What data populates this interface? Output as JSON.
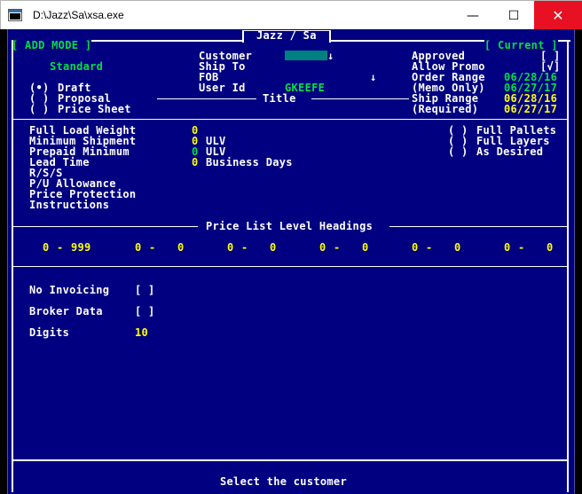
{
  "window": {
    "title": "D:\\Jazz\\Sa\\xsa.exe",
    "minimize_glyph": "—",
    "maximize_glyph": "☐",
    "close_glyph": "✕"
  },
  "header": {
    "app_title": "Jazz / Sa",
    "mode": "[ ADD MODE ]",
    "status": "[ Current ]"
  },
  "top": {
    "standard_label": "Standard",
    "doc_types": [
      {
        "marker": "(•)",
        "label": "Draft"
      },
      {
        "marker": "( )",
        "label": "Proposal"
      },
      {
        "marker": "( )",
        "label": "Price Sheet"
      }
    ],
    "customer_label": "Customer",
    "customer_arrow": "↓",
    "ship_to_label": "Ship To",
    "fob_label": "FOB",
    "fob_arrow": "↓",
    "user_id_label": "User Id",
    "user_id_value": "GKEEFE",
    "title_label": "Title",
    "approved_label": "Approved",
    "approved_value": "[ ]",
    "allow_promo_label": "Allow Promo",
    "allow_promo_value": "[√]",
    "order_range_label": "Order Range",
    "order_range_from": "06/28/16",
    "memo_only_label": "(Memo Only)",
    "order_range_to": "06/27/17",
    "ship_range_label": "Ship Range",
    "ship_range_from": "06/28/16",
    "required_label": "(Required)",
    "ship_range_to": "06/27/17"
  },
  "params": {
    "full_load_weight_label": "Full Load Weight",
    "full_load_weight_value": "0",
    "minimum_shipment_label": "Minimum Shipment",
    "minimum_shipment_value": "0",
    "minimum_shipment_unit": "ULV",
    "prepaid_minimum_label": "Prepaid Minimum",
    "prepaid_minimum_value": "0",
    "prepaid_minimum_unit": "ULV",
    "lead_time_label": "Lead Time",
    "lead_time_value": "0",
    "lead_time_unit": "Business Days",
    "rs_label": "R/S/S",
    "pu_label": "P/U Allowance",
    "price_protection_label": "Price Protection",
    "instructions_label": "Instructions",
    "pallet_options": [
      {
        "marker": "( )",
        "label": "Full Pallets"
      },
      {
        "marker": "( )",
        "label": "Full Layers"
      },
      {
        "marker": "( )",
        "label": "As Desired"
      }
    ]
  },
  "levels": {
    "heading": "Price List Level Headings",
    "ranges": [
      {
        "from": "0",
        "sep": "-",
        "to": "999"
      },
      {
        "from": "0",
        "sep": "-",
        "to": "0"
      },
      {
        "from": "0",
        "sep": "-",
        "to": "0"
      },
      {
        "from": "0",
        "sep": "-",
        "to": "0"
      },
      {
        "from": "0",
        "sep": "-",
        "to": "0"
      },
      {
        "from": "0",
        "sep": "-",
        "to": "0"
      }
    ]
  },
  "bottom": {
    "no_invoicing_label": "No Invoicing",
    "no_invoicing_value": "[ ]",
    "broker_data_label": "Broker Data",
    "broker_data_value": "[ ]",
    "digits_label": "Digits",
    "digits_value": "10"
  },
  "status_bar": {
    "message": "Select the customer"
  }
}
